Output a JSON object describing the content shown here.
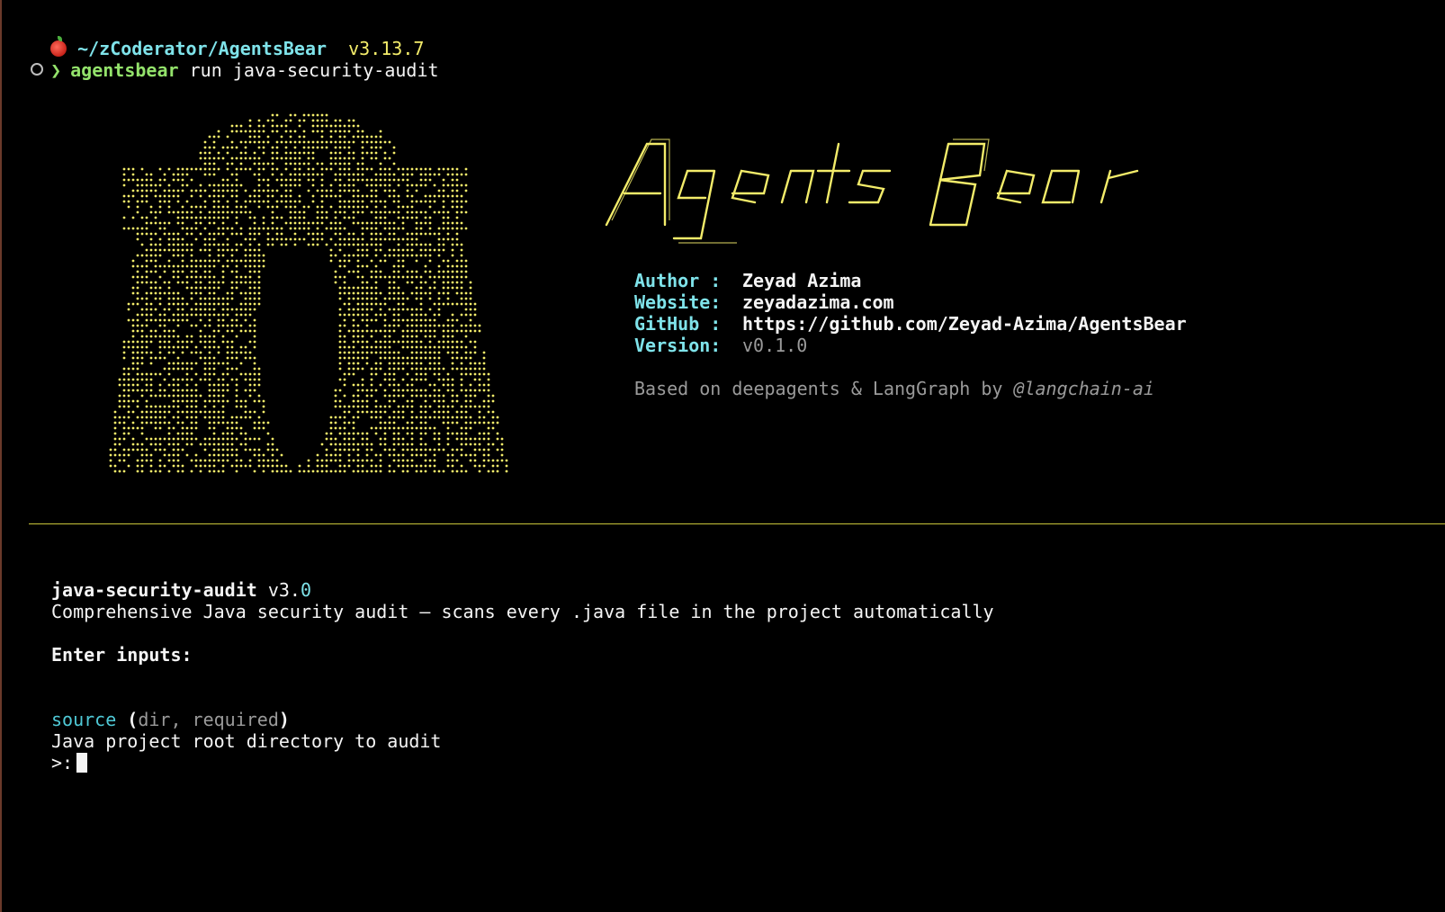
{
  "prompt": {
    "path": "~/zCoderator/AgentsBear",
    "version": "v3.13.7",
    "command_name": "agentsbear",
    "command_args": "run java-security-audit"
  },
  "info": {
    "author_label": "Author :",
    "author_value": "Zeyad Azima",
    "website_label": "Website:",
    "website_value": "zeyadazima.com",
    "github_label": "GitHub :",
    "github_value": "https://github.com/Zeyad-Azima/AgentsBear",
    "version_label": "Version:",
    "version_value": "v0.1.0",
    "based_on_text": "Based on deepagents & LangGraph by ",
    "based_on_handle": "@langchain-ai"
  },
  "task": {
    "name": "java-security-audit",
    "version_prefix": "v3.",
    "version_suffix": "0",
    "description": "Comprehensive Java security audit — scans every .java file in the project automatically",
    "enter_inputs_label": "Enter inputs:",
    "input_name": "source",
    "input_open_paren": " (",
    "input_meta": "dir, required",
    "input_close_paren": ")",
    "input_description": "Java project root directory to audit",
    "input_prompt": ">:"
  },
  "colors": {
    "background": "#000000",
    "cyan_label": "#7fe3ea",
    "green_command": "#93e26b",
    "yellow_accent": "#f3ec6a",
    "divider": "#c9c53a"
  },
  "icons": {
    "prompt_status": "apple-icon",
    "shell_status": "circle-icon",
    "prompt_arrow": "chevron-icon"
  }
}
